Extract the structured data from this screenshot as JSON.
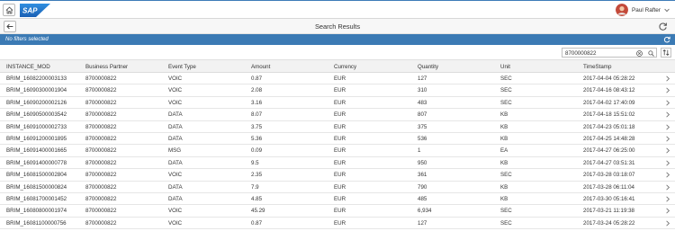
{
  "shell": {
    "logo_text": "SAP",
    "user_name": "Paul Rafter",
    "brand_color": "#3b7ab4"
  },
  "titlebar": {
    "title": "Search Results"
  },
  "filterbar": {
    "text": "No filters selected"
  },
  "search": {
    "value": "8700000822",
    "placeholder": ""
  },
  "table": {
    "columns": [
      "INSTANCE_MOD",
      "Business Partner",
      "Event Type",
      "Amount",
      "Currency",
      "Quantity",
      "Unit",
      "TimeStamp"
    ],
    "rows": [
      [
        "BRIM_16082200003133",
        "8700000822",
        "VOIC",
        "0.87",
        "EUR",
        "127",
        "SEC",
        "2017-04-04 05:28:22"
      ],
      [
        "BRIM_16090300001904",
        "8700000822",
        "VOIC",
        "2.08",
        "EUR",
        "310",
        "SEC",
        "2017-04-16 08:43:12"
      ],
      [
        "BRIM_16090200002126",
        "8700000822",
        "VOIC",
        "3.16",
        "EUR",
        "483",
        "SEC",
        "2017-04-02 17:40:09"
      ],
      [
        "BRIM_16090500003542",
        "8700000822",
        "DATA",
        "8.07",
        "EUR",
        "807",
        "KB",
        "2017-04-18 15:51:02"
      ],
      [
        "BRIM_16091000002733",
        "8700000822",
        "DATA",
        "3.75",
        "EUR",
        "375",
        "KB",
        "2017-04-23 05:01:18"
      ],
      [
        "BRIM_16091200001895",
        "8700000822",
        "DATA",
        "5.36",
        "EUR",
        "536",
        "KB",
        "2017-04-25 14:48:28"
      ],
      [
        "BRIM_16091400001665",
        "8700000822",
        "MSG",
        "0.09",
        "EUR",
        "1",
        "EA",
        "2017-04-27 06:25:00"
      ],
      [
        "BRIM_16091400000778",
        "8700000822",
        "DATA",
        "9.5",
        "EUR",
        "950",
        "KB",
        "2017-04-27 03:51:31"
      ],
      [
        "BRIM_16081500002804",
        "8700000822",
        "VOIC",
        "2.35",
        "EUR",
        "361",
        "SEC",
        "2017-03-28 03:18:07"
      ],
      [
        "BRIM_16081500000824",
        "8700000822",
        "DATA",
        "7.9",
        "EUR",
        "790",
        "KB",
        "2017-03-28 06:11:04"
      ],
      [
        "BRIM_16081700001452",
        "8700000822",
        "DATA",
        "4.85",
        "EUR",
        "485",
        "KB",
        "2017-03-30 05:16:41"
      ],
      [
        "BRIM_16080800001974",
        "8700000822",
        "VOIC",
        "45.29",
        "EUR",
        "6,934",
        "SEC",
        "2017-03-21 11:19:38"
      ],
      [
        "BRIM_16081100000756",
        "8700000822",
        "VOIC",
        "0.87",
        "EUR",
        "127",
        "SEC",
        "2017-03-24 05:28:22"
      ]
    ]
  }
}
